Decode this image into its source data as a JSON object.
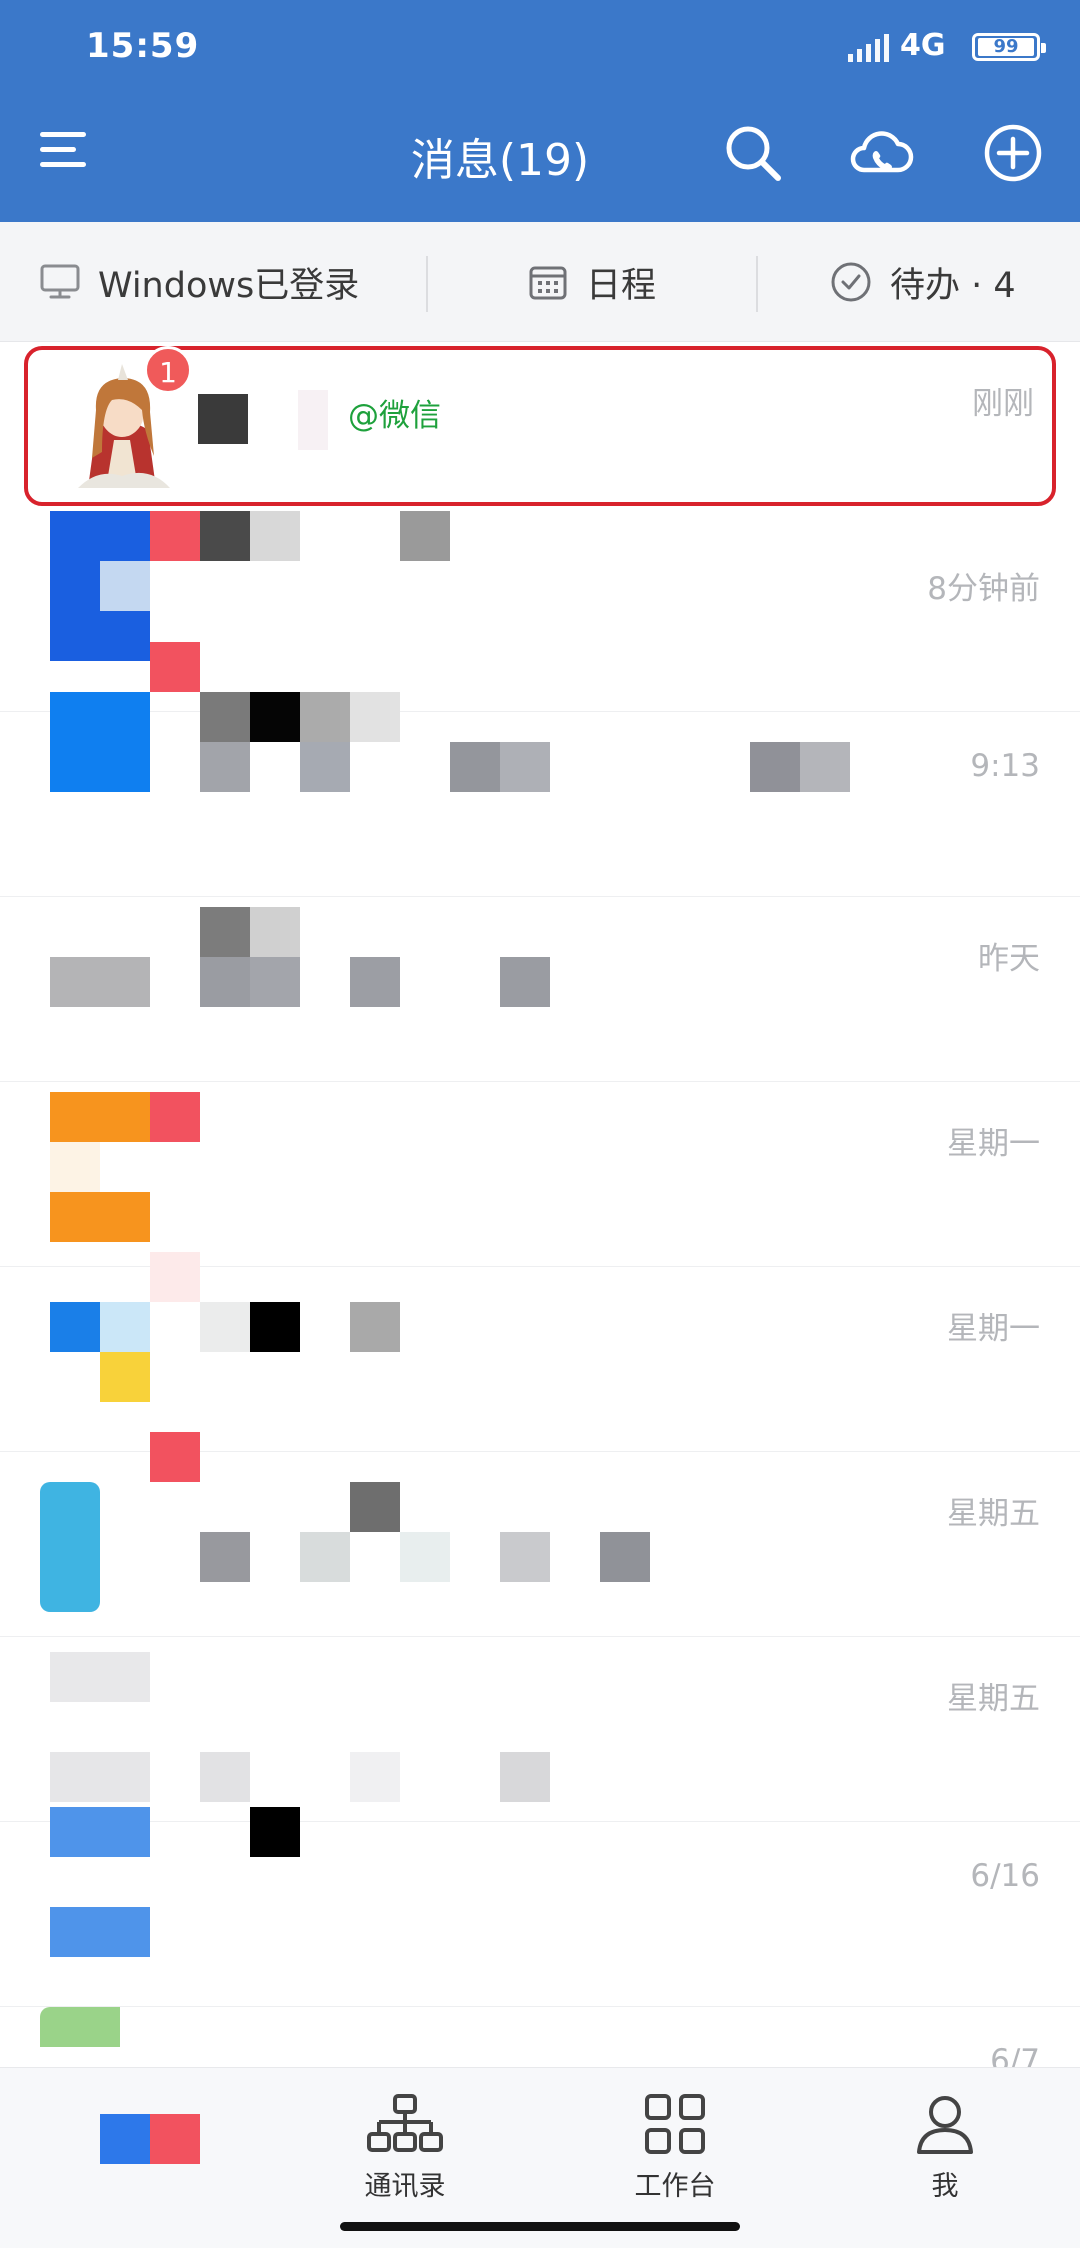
{
  "status_bar": {
    "time": "15:59",
    "network": "4G",
    "battery": "99"
  },
  "header": {
    "title": "消息(19)"
  },
  "quickbar": {
    "windows": "Windows已登录",
    "schedule": "日程",
    "todo": "待办 · 4"
  },
  "messages": [
    {
      "time": "刚刚",
      "badge": "1",
      "mention": "@微信",
      "highlighted": true
    },
    {
      "time": "8分钟前"
    },
    {
      "time": "9:13"
    },
    {
      "time": "昨天"
    },
    {
      "time": "星期一"
    },
    {
      "time": "星期一"
    },
    {
      "time": "星期五"
    },
    {
      "time": "星期五"
    },
    {
      "time": "6/16"
    },
    {
      "time": "6/7"
    }
  ],
  "tabs": [
    {
      "label": "",
      "icon": "messages-icon"
    },
    {
      "label": "通讯录",
      "icon": "contacts-icon"
    },
    {
      "label": "工作台",
      "icon": "workbench-icon"
    },
    {
      "label": "我",
      "icon": "person-icon"
    }
  ],
  "colors": {
    "header_bg": "#3b78c9",
    "highlight_border": "#d8222c",
    "mention": "#1ea13c",
    "badge": "#f05a5a"
  }
}
